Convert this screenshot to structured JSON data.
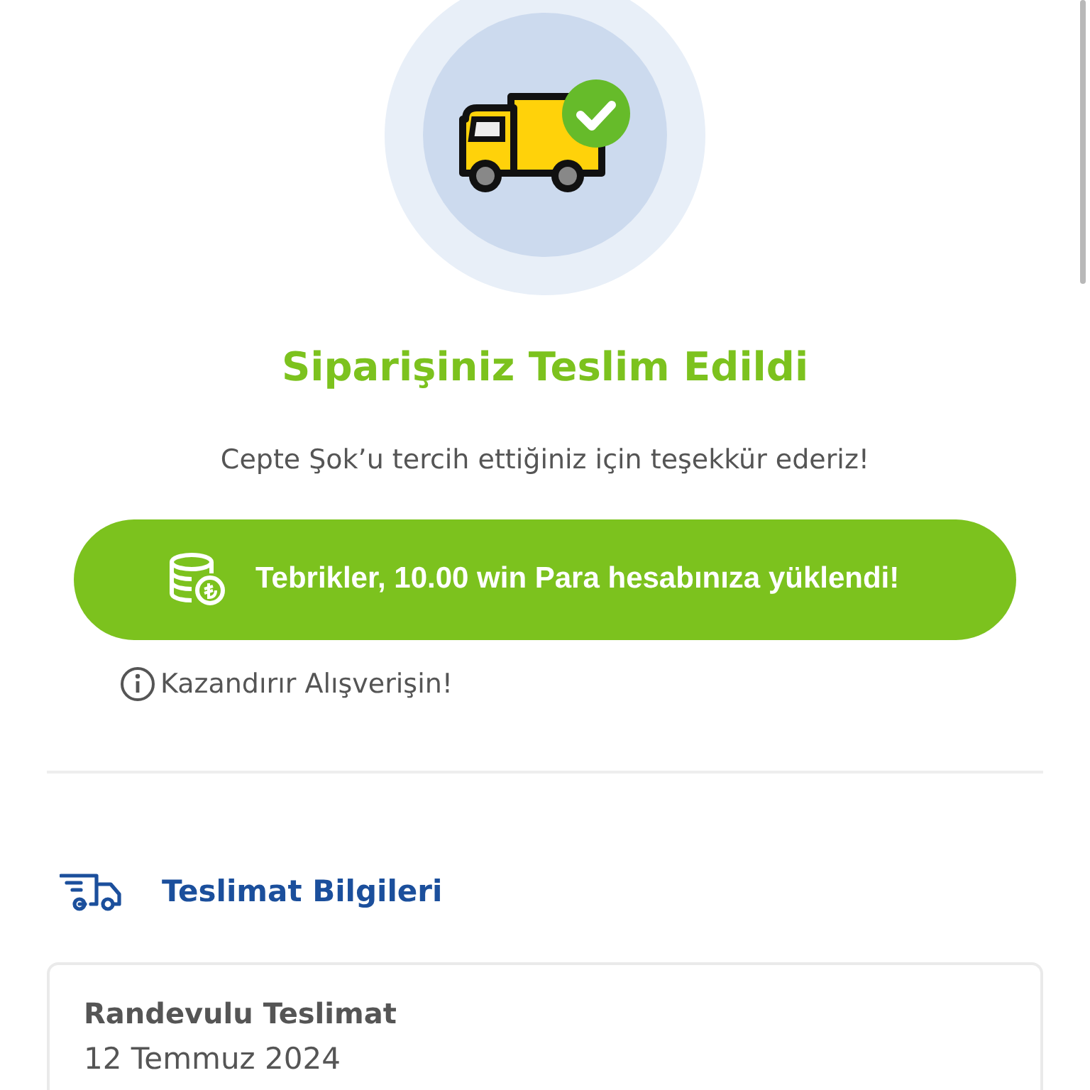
{
  "status": {
    "title": "Siparişiniz Teslim Edildi",
    "message": "Cepte Şok’u tercih ettiğiniz için teşekkür ederiz!"
  },
  "reward": {
    "text": "Tebrikler, 10.00 win Para hesabınıza yüklendi!"
  },
  "info": {
    "text": "Kazandırır Alışverişin!"
  },
  "delivery": {
    "heading": "Teslimat Bilgileri",
    "type": "Randevulu Teslimat",
    "date": "12 Temmuz 2024"
  }
}
